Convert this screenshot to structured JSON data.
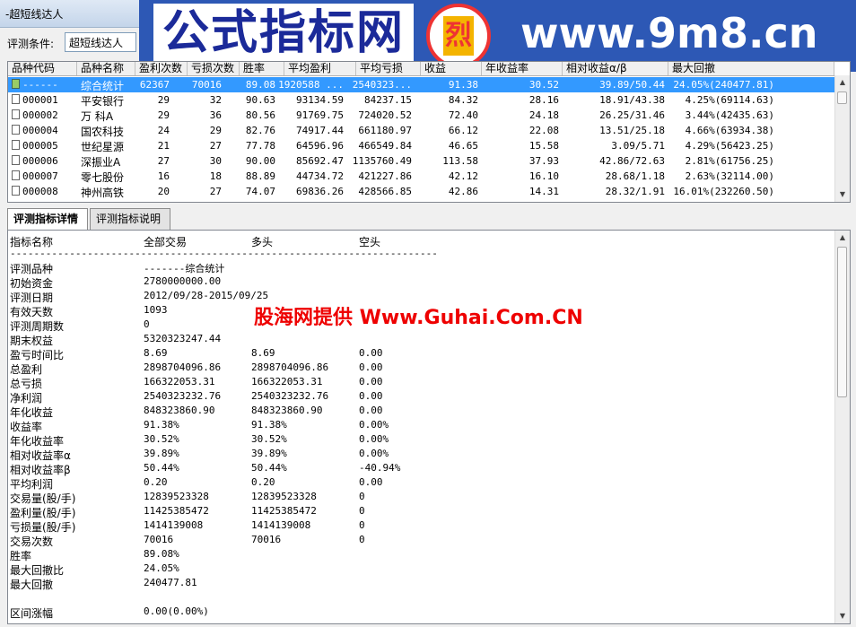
{
  "window": {
    "title": "-超短线达人"
  },
  "banner": {
    "cn_text": "公式指标网",
    "url_text": "www.9m8.cn",
    "logo_char": "烈"
  },
  "condition": {
    "label": "评测条件:",
    "value": "超短线达人"
  },
  "grid": {
    "columns": [
      "品种代码",
      "品种名称",
      "盈利次数",
      "亏损次数",
      "胜率",
      "平均盈利",
      "平均亏损",
      "收益",
      "年收益率",
      "相对收益α/β",
      "最大回撤"
    ],
    "rows": [
      {
        "code": "------",
        "name": "综合统计",
        "c1": "62367",
        "c2": "70016",
        "c3": "89.08",
        "c4": "1920588 ...",
        "c5": "2540323...",
        "c6": "91.38",
        "c7": "30.52",
        "c8": "39.89/50.44",
        "c9": "24.05%(240477.81)"
      },
      {
        "code": "000001",
        "name": "平安银行",
        "c1": "29",
        "c2": "32",
        "c3": "90.63",
        "c4": "93134.59",
        "c5": "84237.15",
        "c6": "84.32",
        "c7": "28.16",
        "c8": "18.91/43.38",
        "c9": "4.25%(69114.63)"
      },
      {
        "code": "000002",
        "name": "万 科A",
        "c1": "29",
        "c2": "36",
        "c3": "80.56",
        "c4": "91769.75",
        "c5": "724020.52",
        "c6": "72.40",
        "c7": "24.18",
        "c8": "26.25/31.46",
        "c9": "3.44%(42435.63)"
      },
      {
        "code": "000004",
        "name": "国农科技",
        "c1": "24",
        "c2": "29",
        "c3": "82.76",
        "c4": "74917.44",
        "c5": "661180.97",
        "c6": "66.12",
        "c7": "22.08",
        "c8": "13.51/25.18",
        "c9": "4.66%(63934.38)"
      },
      {
        "code": "000005",
        "name": "世纪星源",
        "c1": "21",
        "c2": "27",
        "c3": "77.78",
        "c4": "64596.96",
        "c5": "466549.84",
        "c6": "46.65",
        "c7": "15.58",
        "c8": "3.09/5.71",
        "c9": "4.29%(56423.25)"
      },
      {
        "code": "000006",
        "name": "深振业A",
        "c1": "27",
        "c2": "30",
        "c3": "90.00",
        "c4": "85692.47",
        "c5": "1135760.49",
        "c6": "113.58",
        "c7": "37.93",
        "c8": "42.86/72.63",
        "c9": "2.81%(61756.25)"
      },
      {
        "code": "000007",
        "name": "零七股份",
        "c1": "16",
        "c2": "18",
        "c3": "88.89",
        "c4": "44734.72",
        "c5": "421227.86",
        "c6": "42.12",
        "c7": "16.10",
        "c8": "28.68/1.18",
        "c9": "2.63%(32114.00)"
      },
      {
        "code": "000008",
        "name": "神州高铁",
        "c1": "20",
        "c2": "27",
        "c3": "74.07",
        "c4": "69836.26",
        "c5": "428566.85",
        "c6": "42.86",
        "c7": "14.31",
        "c8": "28.32/1.91",
        "c9": "16.01%(232260.50)"
      }
    ]
  },
  "tabs": [
    {
      "label": "评测指标详情"
    },
    {
      "label": "评测指标说明"
    }
  ],
  "detail": {
    "headers": [
      "指标名称",
      "全部交易",
      "多头",
      "空头"
    ],
    "dashes": "------------------------------------------------------------------------",
    "rows": [
      {
        "name": "评测品种",
        "all": "-------综合统计",
        "long": "",
        "short": ""
      },
      {
        "name": "初始资金",
        "all": "2780000000.00",
        "long": "",
        "short": ""
      },
      {
        "name": "评测日期",
        "all": "2012/09/28-2015/09/25",
        "long": "",
        "short": ""
      },
      {
        "name": "有效天数",
        "all": "1093",
        "long": "",
        "short": ""
      },
      {
        "name": "评测周期数",
        "all": "0",
        "long": "",
        "short": ""
      },
      {
        "name": "期末权益",
        "all": "5320323247.44",
        "long": "",
        "short": ""
      },
      {
        "name": "盈亏时间比",
        "all": "8.69",
        "long": "8.69",
        "short": "0.00"
      },
      {
        "name": "总盈利",
        "all": "2898704096.86",
        "long": "2898704096.86",
        "short": "0.00"
      },
      {
        "name": "总亏损",
        "all": "166322053.31",
        "long": "166322053.31",
        "short": "0.00"
      },
      {
        "name": "净利润",
        "all": "2540323232.76",
        "long": "2540323232.76",
        "short": "0.00"
      },
      {
        "name": "年化收益",
        "all": "848323860.90",
        "long": "848323860.90",
        "short": "0.00"
      },
      {
        "name": "收益率",
        "all": "91.38%",
        "long": "91.38%",
        "short": "0.00%"
      },
      {
        "name": "年化收益率",
        "all": "30.52%",
        "long": "30.52%",
        "short": "0.00%"
      },
      {
        "name": "相对收益率α",
        "all": "39.89%",
        "long": "39.89%",
        "short": "0.00%"
      },
      {
        "name": "相对收益率β",
        "all": "50.44%",
        "long": "50.44%",
        "short": "-40.94%"
      },
      {
        "name": "平均利润",
        "all": "0.20",
        "long": "0.20",
        "short": "0.00"
      },
      {
        "name": "交易量(股/手)",
        "all": "12839523328",
        "long": "12839523328",
        "short": "0"
      },
      {
        "name": "盈利量(股/手)",
        "all": "11425385472",
        "long": "11425385472",
        "short": "0"
      },
      {
        "name": "亏损量(股/手)",
        "all": "1414139008",
        "long": "1414139008",
        "short": "0"
      },
      {
        "name": "交易次数",
        "all": "70016",
        "long": "70016",
        "short": "0"
      },
      {
        "name": "胜率",
        "all": "89.08%",
        "long": "",
        "short": ""
      },
      {
        "name": "最大回撤比",
        "all": "24.05%",
        "long": "",
        "short": ""
      },
      {
        "name": "最大回撤",
        "all": "240477.81",
        "long": "",
        "short": ""
      },
      {
        "name": "",
        "all": "",
        "long": "",
        "short": ""
      },
      {
        "name": "区间涨幅",
        "all": "0.00(0.00%)",
        "long": "",
        "short": ""
      }
    ]
  },
  "watermark": "股海网提供 Www.Guhai.Com.CN"
}
